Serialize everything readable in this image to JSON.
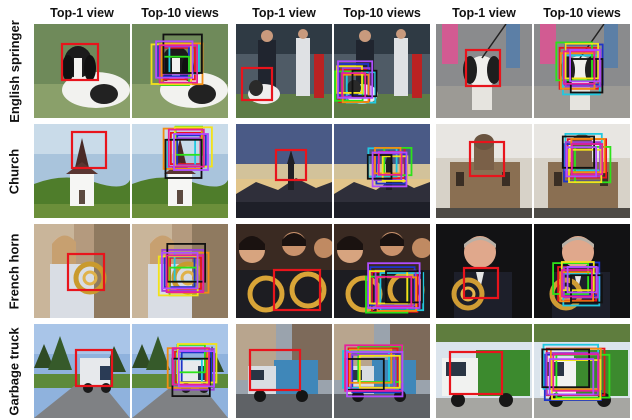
{
  "column_headers": [
    "Top-1 view",
    "Top-10 views",
    "Top-1 view",
    "Top-10 views",
    "Top-1 view",
    "Top-10 views"
  ],
  "row_labels": [
    "English springer",
    "Church",
    "French horn",
    "Garbage truck"
  ],
  "box_colors": {
    "top1": "#e8141c",
    "top10": [
      "#e8141c",
      "#1d35c9",
      "#21c8e0",
      "#2de21a",
      "#9b3fd6",
      "#f28d12",
      "#f3e21a",
      "#111111",
      "#e81f9a",
      "#b04dff"
    ]
  },
  "scenes": [
    [
      "puppy-on-grass",
      "dog-show",
      "dog-on-leash"
    ],
    [
      "white-chapel",
      "sunset-hills",
      "stone-church"
    ],
    [
      "girl-with-horn",
      "horn-section",
      "man-with-horn"
    ],
    [
      "truck-on-road",
      "city-truck",
      "green-truck"
    ]
  ]
}
